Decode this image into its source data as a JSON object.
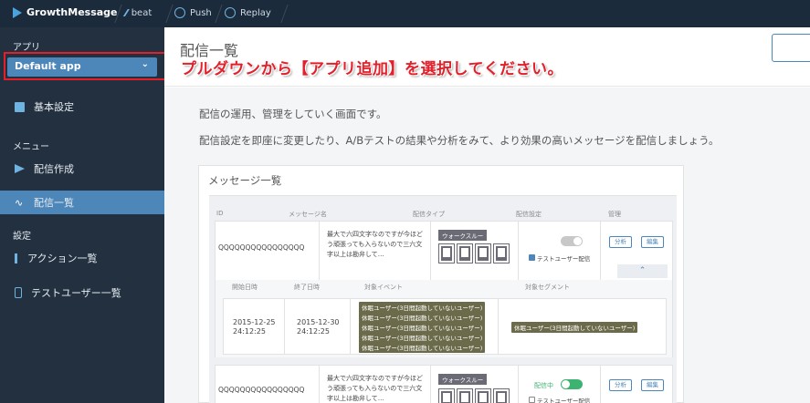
{
  "topbar": {
    "app_name": "GrowthMessage",
    "nav": [
      {
        "label": "beat",
        "icon": "beat-icon"
      },
      {
        "label": "Push",
        "icon": "push-icon"
      },
      {
        "label": "Replay",
        "icon": "replay-icon"
      }
    ]
  },
  "sidebar": {
    "app_section": "アプリ",
    "selected_app": "Default app",
    "basic_settings": "基本設定",
    "menu_section": "メニュー",
    "menu_items": [
      "配信作成",
      "配信一覧"
    ],
    "settings_section": "設定",
    "settings_items": [
      "アクション一覧",
      "テストユーザー一覧"
    ]
  },
  "header": {
    "title": "配信一覧",
    "instruction": "プルダウンから【アプリ追加】を選択してください。"
  },
  "description": [
    "配信の運用、管理をしていく画面です。",
    "配信設定を即座に変更したり、A/Bテストの結果や分析をみて、より効果の高いメッセージを配信しましょう。"
  ],
  "panel": {
    "title": "メッセージ一覧",
    "columns": [
      "ID",
      "メッセージ名",
      "配信タイプ",
      "配信設定",
      "管理"
    ],
    "rows": [
      {
        "id": "QQQQQQQQQQQQQQQQ",
        "message": "最大で六四文字なのですが今ほどう頑張っても入らないので三六文字以上は勘弁して…",
        "type": "ウォークスルー",
        "status": "",
        "test_user": "テストユーザー配信",
        "actions": [
          "分析",
          "編集"
        ]
      },
      {
        "id": "QQQQQQQQQQQQQQQQ",
        "message": "最大で六四文字なのですが今ほどう頑張っても入らないので三六文字以上は勘弁して…",
        "type": "ウォークスルー",
        "status": "配信中",
        "test_user": "テストユーザー配信",
        "actions": [
          "分析",
          "編集"
        ]
      }
    ],
    "sub_columns": [
      "開始日時",
      "終了日時",
      "対象イベント",
      "対象セグメント"
    ],
    "sub_row": {
      "start_date": "2015-12-25",
      "start_time": "24:12:25",
      "end_date": "2015-12-30",
      "end_time": "24:12:25",
      "events": [
        "休眠ユーザー(3日間起動していないユーザー)",
        "休眠ユーザー(3日間起動していないユーザー)",
        "休眠ユーザー(3日間起動していないユーザー)",
        "休眠ユーザー(3日間起動していないユーザー)",
        "休眠ユーザー(3日間起動していないユーザー)"
      ],
      "segment": "休眠ユーザー(3日間起動していないユーザー)"
    }
  },
  "colors": {
    "sidebar_bg": "#22303f",
    "accent": "#4d86b8",
    "highlight_red": "#e3202a",
    "toggle_on": "#3cb371",
    "toggle_off": "#c8c8c8"
  }
}
